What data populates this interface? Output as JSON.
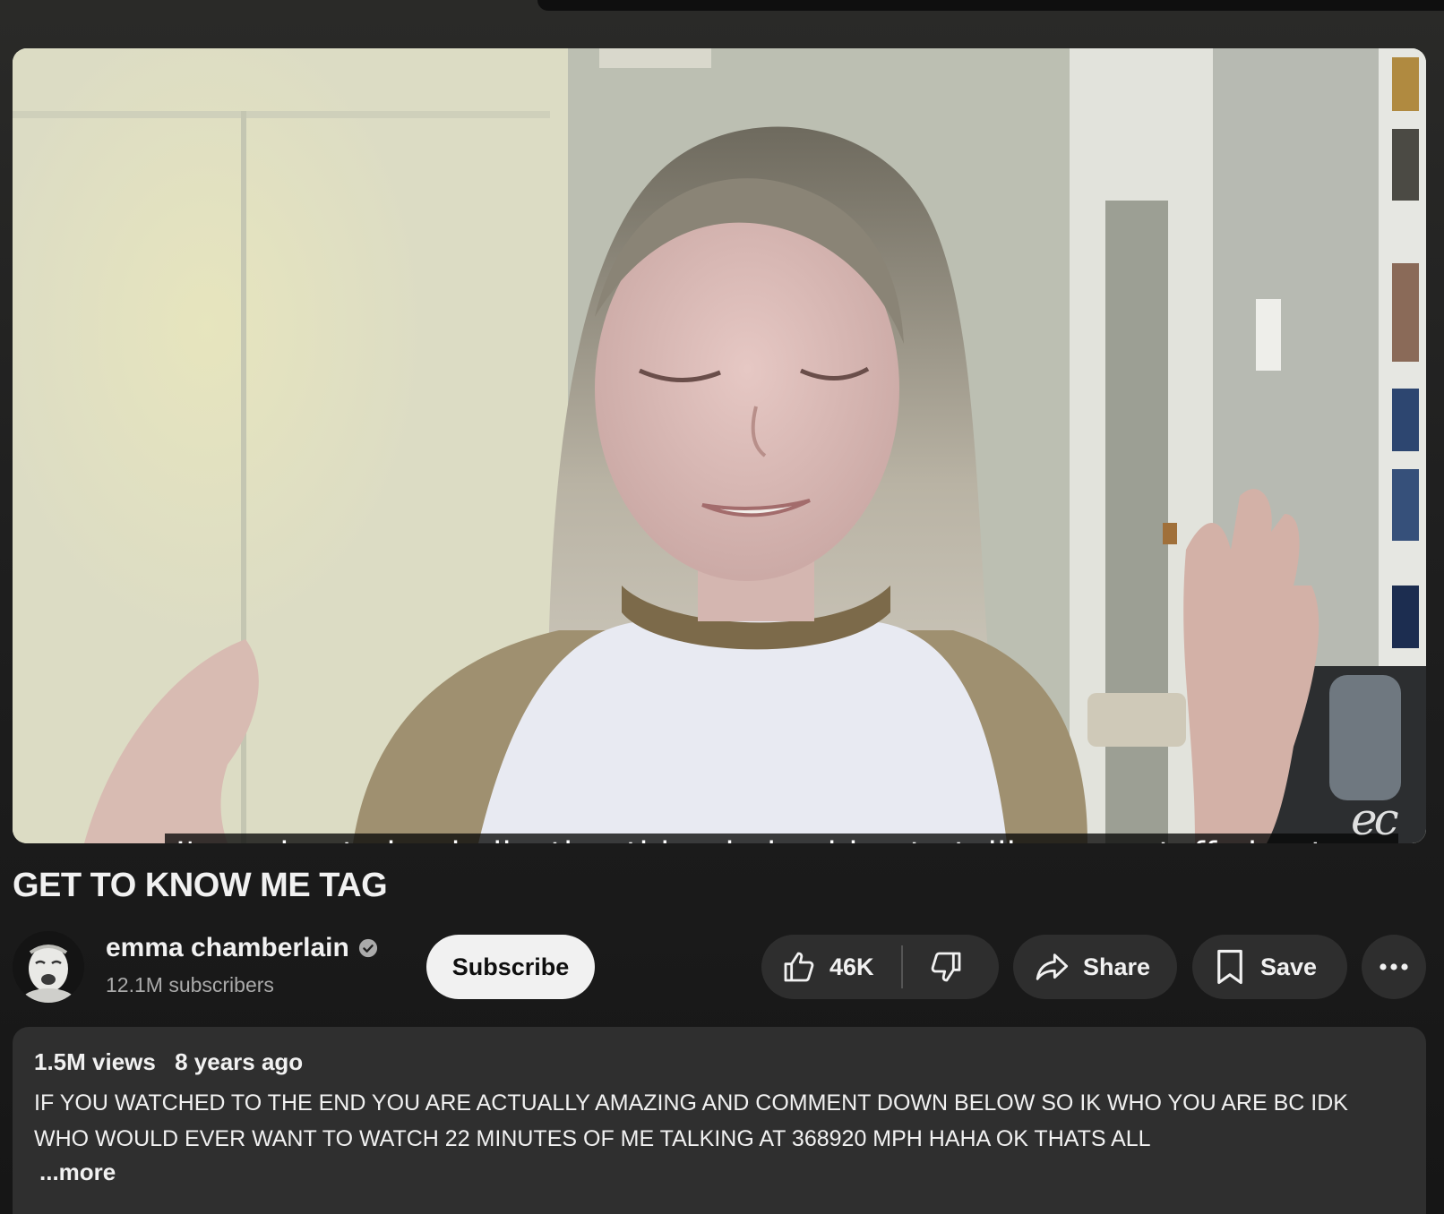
{
  "video": {
    "caption": "I'm going to be dedicating this whole video to telling you stuff about me",
    "watermark": "ec",
    "title": "GET TO KNOW ME TAG"
  },
  "channel": {
    "name": "emma chamberlain",
    "subscribers": "12.1M subscribers",
    "verified": true,
    "avatar_icon": "avatar-icon"
  },
  "actions": {
    "subscribe_label": "Subscribe",
    "like_count": "46K",
    "share_label": "Share",
    "save_label": "Save",
    "icons": [
      "like-icon",
      "dislike-icon",
      "share-icon",
      "save-icon",
      "more-icon"
    ]
  },
  "description": {
    "views": "1.5M views",
    "age": "8 years ago",
    "text": "IF YOU WATCHED TO THE END YOU ARE ACTUALLY AMAZING AND COMMENT DOWN BELOW SO IK WHO YOU ARE BC IDK WHO WOULD EVER WANT TO WATCH 22 MINUTES OF ME TALKING AT 368920 MPH HAHA OK THATS ALL",
    "more_label": "...more"
  },
  "colors": {
    "background": "#1f1f1f",
    "button": "#2e2e2e",
    "subscribe_bg": "#f1f1f1",
    "text": "#f1f1f1",
    "secondary_text": "#aaaaaa"
  }
}
